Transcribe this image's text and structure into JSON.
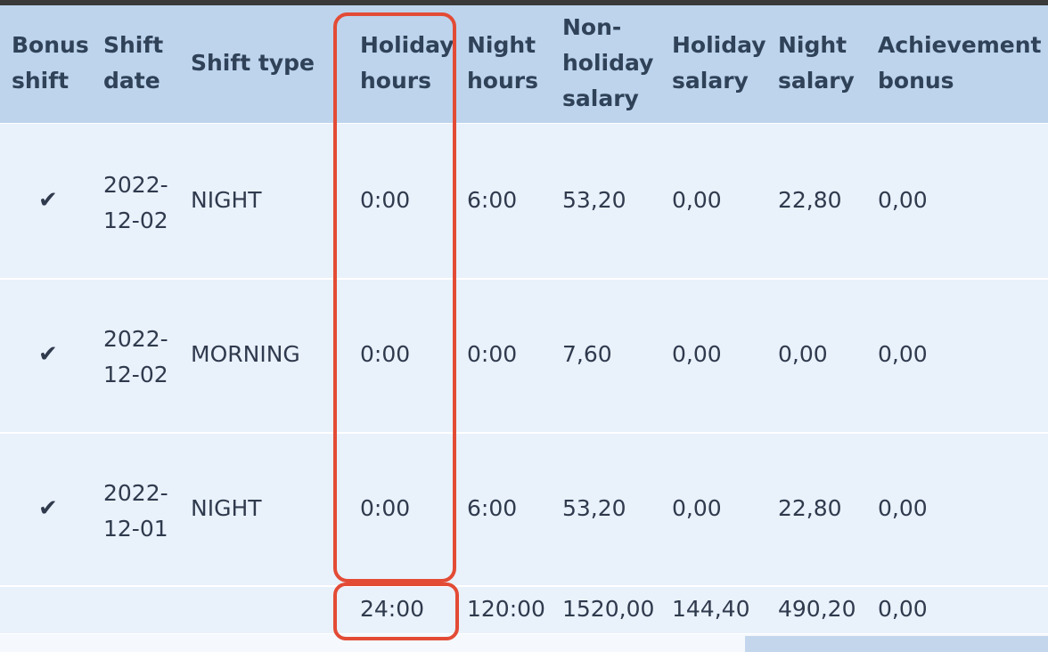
{
  "headers": {
    "bonus_shift": [
      "Bonus",
      "shift"
    ],
    "shift_date": [
      "Shift",
      "date"
    ],
    "shift_type": "Shift type",
    "holiday_hours": [
      "Holiday",
      "hours"
    ],
    "night_hours": [
      "Night",
      "hours"
    ],
    "non_holiday_salary": [
      "Non-",
      "holiday",
      "salary"
    ],
    "holiday_salary": [
      "Holiday",
      "salary"
    ],
    "night_salary": [
      "Night",
      "salary"
    ],
    "achievement_bonus": [
      "Achievement",
      "bonus"
    ]
  },
  "rows": [
    {
      "bonus": "✔",
      "date": [
        "2022-",
        "12-02"
      ],
      "type": "NIGHT",
      "holiday_hours": "0:00",
      "night_hours": "6:00",
      "non_holiday_salary": "53,20",
      "holiday_salary": "0,00",
      "night_salary": "22,80",
      "achievement_bonus": "0,00"
    },
    {
      "bonus": "✔",
      "date": [
        "2022-",
        "12-02"
      ],
      "type": "MORNING",
      "holiday_hours": "0:00",
      "night_hours": "0:00",
      "non_holiday_salary": "7,60",
      "holiday_salary": "0,00",
      "night_salary": "0,00",
      "achievement_bonus": "0,00"
    },
    {
      "bonus": "✔",
      "date": [
        "2022-",
        "12-01"
      ],
      "type": "NIGHT",
      "holiday_hours": "0:00",
      "night_hours": "6:00",
      "non_holiday_salary": "53,20",
      "holiday_salary": "0,00",
      "night_salary": "22,80",
      "achievement_bonus": "0,00"
    }
  ],
  "totals": {
    "holiday_hours": "24:00",
    "night_hours": "120:00",
    "non_holiday_salary": "1520,00",
    "holiday_salary": "144,40",
    "night_salary": "490,20",
    "achievement_bonus": "0,00"
  },
  "colors": {
    "header_bg": "#bdd4ec",
    "row_bg": "#e9f1fb",
    "highlight": "#e34b35",
    "text": "#2f3a4d"
  }
}
